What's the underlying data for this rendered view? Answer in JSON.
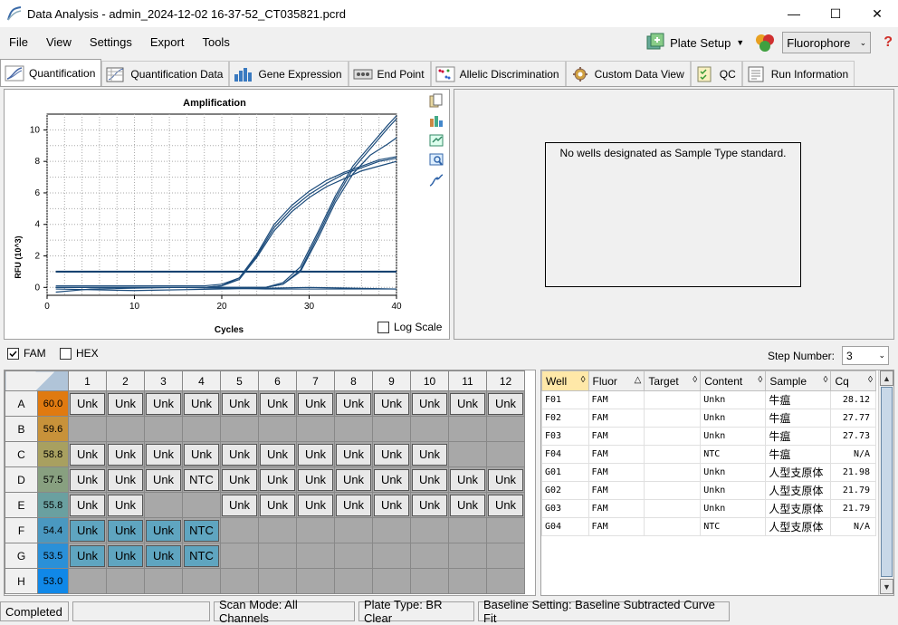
{
  "window": {
    "title": "Data Analysis - admin_2024-12-02 16-37-52_CT035821.pcrd",
    "minimize": "—",
    "maximize": "☐",
    "close": "✕"
  },
  "menu": [
    "File",
    "View",
    "Settings",
    "Export",
    "Tools"
  ],
  "toolbar": {
    "plate_setup": "Plate Setup",
    "fluorophore": "Fluorophore",
    "help": "?"
  },
  "tabs": [
    {
      "label": "Quantification",
      "icon": "amplification-icon",
      "active": true
    },
    {
      "label": "Quantification Data",
      "icon": "data-icon"
    },
    {
      "label": "Gene Expression",
      "icon": "bar-chart-icon"
    },
    {
      "label": "End Point",
      "icon": "endpoint-icon"
    },
    {
      "label": "Allelic Discrimination",
      "icon": "scatter-icon"
    },
    {
      "label": "Custom Data View",
      "icon": "gear-icon"
    },
    {
      "label": "QC",
      "icon": "checklist-icon"
    },
    {
      "label": "Run Information",
      "icon": "info-icon"
    }
  ],
  "chart_data": {
    "type": "line",
    "title": "Amplification",
    "xlabel": "Cycles",
    "ylabel": "RFU (10^3)",
    "xlim": [
      0,
      40
    ],
    "ylim": [
      -0.5,
      11
    ],
    "xticks": [
      0,
      10,
      20,
      30,
      40
    ],
    "yticks": [
      0,
      2,
      4,
      6,
      8,
      10
    ],
    "threshold": 1.0,
    "series": [
      {
        "values": [
          [
            1,
            0.1
          ],
          [
            10,
            0.1
          ],
          [
            18,
            0.1
          ],
          [
            20,
            0.2
          ],
          [
            22,
            0.6
          ],
          [
            24,
            2.0
          ],
          [
            26,
            3.8
          ],
          [
            28,
            5.0
          ],
          [
            30,
            5.9
          ],
          [
            32,
            6.6
          ],
          [
            34,
            7.2
          ],
          [
            36,
            7.6
          ],
          [
            38,
            8.0
          ],
          [
            40,
            8.2
          ]
        ]
      },
      {
        "values": [
          [
            1,
            0.0
          ],
          [
            10,
            0.0
          ],
          [
            18,
            0.0
          ],
          [
            20,
            0.1
          ],
          [
            22,
            0.6
          ],
          [
            24,
            2.1
          ],
          [
            26,
            4.0
          ],
          [
            28,
            5.2
          ],
          [
            30,
            6.1
          ],
          [
            32,
            6.8
          ],
          [
            34,
            7.3
          ],
          [
            36,
            7.7
          ],
          [
            38,
            8.1
          ],
          [
            40,
            8.3
          ]
        ]
      },
      {
        "values": [
          [
            1,
            0.0
          ],
          [
            10,
            0.0
          ],
          [
            18,
            0.0
          ],
          [
            20,
            0.1
          ],
          [
            22,
            0.5
          ],
          [
            24,
            1.9
          ],
          [
            26,
            3.6
          ],
          [
            28,
            4.8
          ],
          [
            30,
            5.7
          ],
          [
            32,
            6.4
          ],
          [
            34,
            6.9
          ],
          [
            36,
            7.4
          ],
          [
            38,
            7.7
          ],
          [
            40,
            8.0
          ]
        ]
      },
      {
        "values": [
          [
            1,
            0.0
          ],
          [
            20,
            0.0
          ],
          [
            25,
            0.0
          ],
          [
            27,
            0.3
          ],
          [
            29,
            1.3
          ],
          [
            31,
            3.5
          ],
          [
            33,
            5.8
          ],
          [
            35,
            7.7
          ],
          [
            37,
            9.0
          ],
          [
            39,
            10.3
          ],
          [
            40,
            10.9
          ]
        ]
      },
      {
        "values": [
          [
            1,
            0.0
          ],
          [
            20,
            0.0
          ],
          [
            25,
            0.0
          ],
          [
            27,
            0.2
          ],
          [
            29,
            1.1
          ],
          [
            31,
            3.3
          ],
          [
            33,
            5.6
          ],
          [
            35,
            7.5
          ],
          [
            37,
            8.8
          ],
          [
            39,
            10.1
          ],
          [
            40,
            10.7
          ]
        ]
      },
      {
        "values": [
          [
            1,
            0.0
          ],
          [
            20,
            0.0
          ],
          [
            25,
            0.0
          ],
          [
            27,
            0.2
          ],
          [
            29,
            1.0
          ],
          [
            31,
            3.1
          ],
          [
            33,
            5.4
          ],
          [
            35,
            7.2
          ],
          [
            37,
            8.4
          ],
          [
            39,
            9.1
          ],
          [
            40,
            9.5
          ]
        ]
      },
      {
        "values": [
          [
            1,
            -0.1
          ],
          [
            10,
            -0.2
          ],
          [
            20,
            -0.1
          ],
          [
            30,
            0.0
          ],
          [
            40,
            -0.1
          ]
        ]
      },
      {
        "values": [
          [
            1,
            -0.3
          ],
          [
            5,
            -0.1
          ],
          [
            15,
            0.0
          ],
          [
            25,
            -0.1
          ],
          [
            40,
            -0.1
          ]
        ]
      }
    ],
    "log_scale_label": "Log Scale",
    "grid": true
  },
  "standard_panel": {
    "message": "No wells designated as Sample Type standard."
  },
  "fluors": [
    {
      "label": "FAM",
      "checked": true
    },
    {
      "label": "HEX",
      "checked": false
    }
  ],
  "step": {
    "label": "Step Number:",
    "value": "3"
  },
  "plate": {
    "columns": [
      "1",
      "2",
      "3",
      "4",
      "5",
      "6",
      "7",
      "8",
      "9",
      "10",
      "11",
      "12"
    ],
    "rows": [
      {
        "label": "A",
        "temp": "60.0",
        "color": "#e07a10",
        "wells": [
          "Unk",
          "Unk",
          "Unk",
          "Unk",
          "Unk",
          "Unk",
          "Unk",
          "Unk",
          "Unk",
          "Unk",
          "Unk",
          "Unk"
        ],
        "sel": []
      },
      {
        "label": "B",
        "temp": "59.6",
        "color": "#c8923a",
        "wells": [
          "",
          "",
          "",
          "",
          "",
          "",
          "",
          "",
          "",
          "",
          "",
          ""
        ],
        "sel": []
      },
      {
        "label": "C",
        "temp": "58.8",
        "color": "#a8a060",
        "wells": [
          "Unk",
          "Unk",
          "Unk",
          "Unk",
          "Unk",
          "Unk",
          "Unk",
          "Unk",
          "Unk",
          "Unk",
          "",
          ""
        ],
        "sel": []
      },
      {
        "label": "D",
        "temp": "57.5",
        "color": "#88a080",
        "wells": [
          "Unk",
          "Unk",
          "Unk",
          "NTC",
          "Unk",
          "Unk",
          "Unk",
          "Unk",
          "Unk",
          "Unk",
          "Unk",
          "Unk"
        ],
        "sel": []
      },
      {
        "label": "E",
        "temp": "55.8",
        "color": "#6aa0a0",
        "wells": [
          "Unk",
          "Unk",
          "",
          "",
          "Unk",
          "Unk",
          "Unk",
          "Unk",
          "Unk",
          "Unk",
          "Unk",
          "Unk"
        ],
        "sel": []
      },
      {
        "label": "F",
        "temp": "54.4",
        "color": "#4a98c0",
        "wells": [
          "Unk",
          "Unk",
          "Unk",
          "NTC",
          "",
          "",
          "",
          "",
          "",
          "",
          "",
          ""
        ],
        "sel": [
          0,
          1,
          2,
          3
        ]
      },
      {
        "label": "G",
        "temp": "53.5",
        "color": "#2a90d8",
        "wells": [
          "Unk",
          "Unk",
          "Unk",
          "NTC",
          "",
          "",
          "",
          "",
          "",
          "",
          "",
          ""
        ],
        "sel": [
          0,
          1,
          2,
          3
        ]
      },
      {
        "label": "H",
        "temp": "53.0",
        "color": "#1088e8",
        "wells": [
          "",
          "",
          "",
          "",
          "",
          "",
          "",
          "",
          "",
          "",
          "",
          ""
        ],
        "sel": []
      }
    ]
  },
  "results": {
    "headers": [
      "Well",
      "Fluor",
      "Target",
      "Content",
      "Sample",
      "Cq"
    ],
    "rows": [
      [
        "F01",
        "FAM",
        "",
        "Unkn",
        "牛瘟",
        "28.12"
      ],
      [
        "F02",
        "FAM",
        "",
        "Unkn",
        "牛瘟",
        "27.77"
      ],
      [
        "F03",
        "FAM",
        "",
        "Unkn",
        "牛瘟",
        "27.73"
      ],
      [
        "F04",
        "FAM",
        "",
        "NTC",
        "牛瘟",
        "N/A"
      ],
      [
        "G01",
        "FAM",
        "",
        "Unkn",
        "人型支原体",
        "21.98"
      ],
      [
        "G02",
        "FAM",
        "",
        "Unkn",
        "人型支原体",
        "21.79"
      ],
      [
        "G03",
        "FAM",
        "",
        "Unkn",
        "人型支原体",
        "21.79"
      ],
      [
        "G04",
        "FAM",
        "",
        "NTC",
        "人型支原体",
        "N/A"
      ]
    ]
  },
  "status": {
    "state": "Completed",
    "scan_mode": "Scan Mode: All Channels",
    "plate_type": "Plate Type: BR Clear",
    "baseline": "Baseline Setting: Baseline Subtracted Curve Fit"
  }
}
